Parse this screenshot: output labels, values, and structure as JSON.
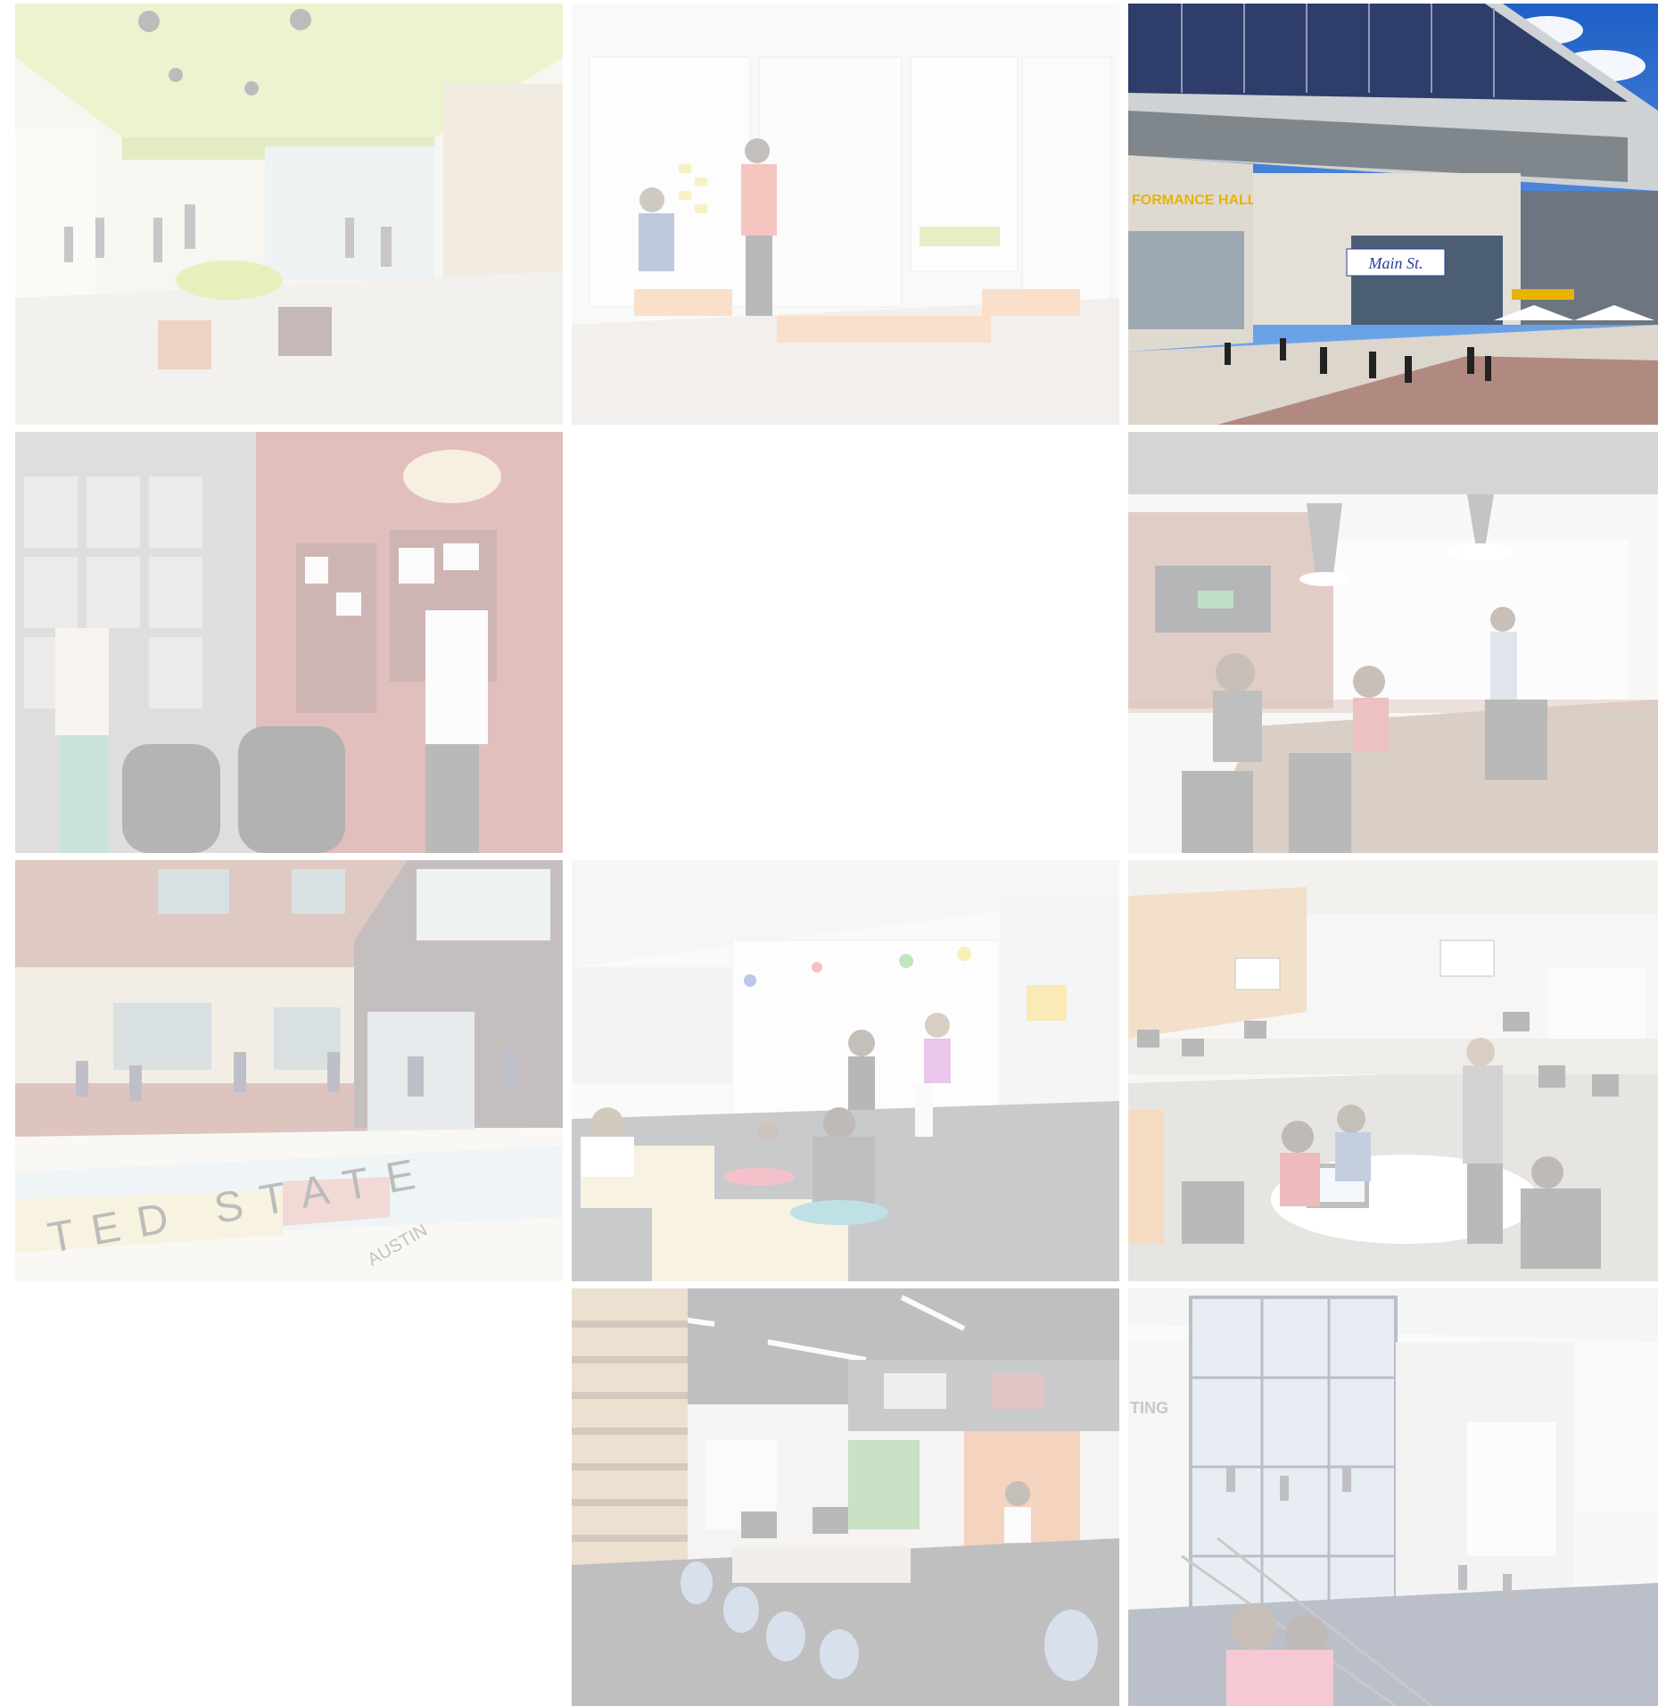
{
  "gallery": {
    "tiles": [
      {
        "id": "interior-learning-commons",
        "state": "faded"
      },
      {
        "id": "whiteboard-collaboration-room",
        "state": "faded"
      },
      {
        "id": "performing-arts-exterior",
        "state": "active",
        "signs": {
          "hall_sign": "FORMANCE HALL",
          "banner": "Main St."
        }
      },
      {
        "id": "red-wall-collaboration",
        "state": "faded"
      },
      {
        "id": "empty-slot-1",
        "state": "empty"
      },
      {
        "id": "conference-room-brick",
        "state": "faded"
      },
      {
        "id": "school-entrance-map-plaza",
        "state": "faded",
        "ground_text": {
          "map_text": "TED STATE",
          "city": "AUSTIN"
        }
      },
      {
        "id": "kids-whiteboard-room",
        "state": "faded"
      },
      {
        "id": "open-office-workstations",
        "state": "faded"
      },
      {
        "id": "empty-slot-2",
        "state": "empty"
      },
      {
        "id": "loft-office-mezzanine",
        "state": "faded"
      },
      {
        "id": "atrium-glass-stair",
        "state": "faded",
        "wall_text": "TING"
      }
    ]
  },
  "colors": {
    "sky": "#3a7fd9",
    "accent_yellow": "#e8b400",
    "banner_text": "#2a3d9a",
    "wall_red": "#a53a33",
    "lime": "#b8d04a",
    "orange_bench": "#f0a060"
  }
}
